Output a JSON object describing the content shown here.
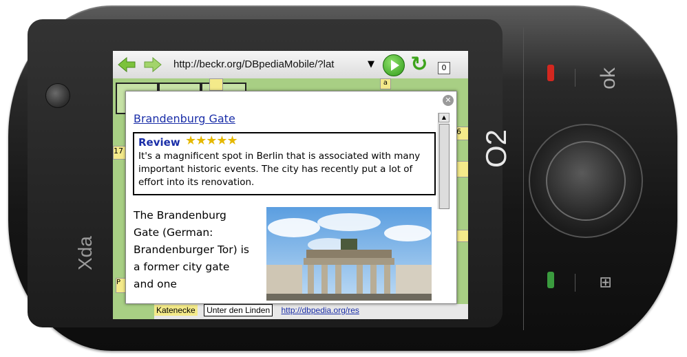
{
  "device": {
    "brand_left": "Xda",
    "brand_right": "O2",
    "ok_key": "ok",
    "windows_key_icon": "windows-icon"
  },
  "browser": {
    "url": "http://beckr.org/DBpediaMobile/?lat",
    "back_icon": "back-arrow-icon",
    "forward_icon": "forward-arrow-icon",
    "go_icon": "go-play-icon",
    "refresh_icon": "refresh-icon",
    "tab_count": "0"
  },
  "map": {
    "labels": {
      "l1": "17",
      "l2": "6",
      "l3": "a",
      "l4": "P"
    },
    "bottom_items": [
      "Katenecke",
      "Unter den Linden",
      "http://dbpedia.org/res"
    ]
  },
  "popup": {
    "title": "Brandenburg Gate",
    "review_label": "Review",
    "rating": 5,
    "stars": "★★★★★",
    "review_text": "It's a magnificent spot in Berlin that is associated with many important historic events. The city has recently put a lot of effort into its renovation.",
    "description": "The Brandenburg Gate (German: Brandenburger Tor) is a former city gate and one"
  },
  "colors": {
    "link": "#1a2ea8",
    "star": "#e5b800",
    "call_red": "#d3271f",
    "call_green": "#3a9b3e"
  }
}
